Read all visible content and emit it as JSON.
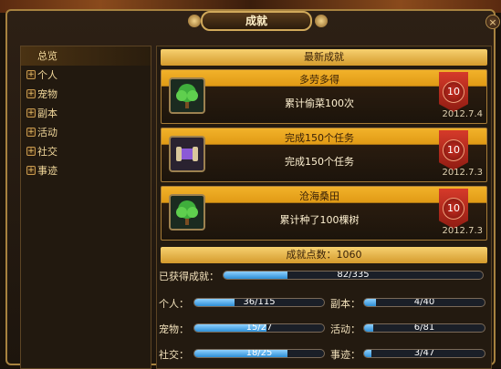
{
  "window": {
    "title": "成就",
    "close_label": "×"
  },
  "sidebar": {
    "items": [
      {
        "label": "总览",
        "expandable": false,
        "selected": true
      },
      {
        "label": "个人",
        "expandable": true
      },
      {
        "label": "宠物",
        "expandable": true
      },
      {
        "label": "副本",
        "expandable": true
      },
      {
        "label": "活动",
        "expandable": true
      },
      {
        "label": "社交",
        "expandable": true
      },
      {
        "label": "事迹",
        "expandable": true
      }
    ],
    "expand_glyph": "+"
  },
  "recent": {
    "header": "最新成就",
    "cards": [
      {
        "title": "多劳多得",
        "desc": "累计偷菜100次",
        "points": "10",
        "date": "2012.7.4",
        "icon": "tree-icon"
      },
      {
        "title": "完成150个任务",
        "desc": "完成150个任务",
        "points": "10",
        "date": "2012.7.3",
        "icon": "scroll-icon"
      },
      {
        "title": "沧海桑田",
        "desc": "累计种了100棵树",
        "points": "10",
        "date": "2012.7.3",
        "icon": "tree-icon"
      }
    ]
  },
  "points": {
    "label": "成就点数：1060"
  },
  "progress": {
    "total": {
      "label": "已获得成就：",
      "value": 82,
      "max": 335,
      "text": "82/335"
    },
    "stats": [
      {
        "label": "个人：",
        "value": 36,
        "max": 115,
        "text": "36/115"
      },
      {
        "label": "副本：",
        "value": 4,
        "max": 40,
        "text": "4/40"
      },
      {
        "label": "宠物：",
        "value": 15,
        "max": 27,
        "text": "15/27"
      },
      {
        "label": "活动：",
        "value": 6,
        "max": 81,
        "text": "6/81"
      },
      {
        "label": "社交：",
        "value": 18,
        "max": 25,
        "text": "18/25"
      },
      {
        "label": "事迹：",
        "value": 3,
        "max": 47,
        "text": "3/47"
      }
    ]
  },
  "colors": {
    "gold": "#f2b22a",
    "frame": "#a7823f",
    "bar_fill": "#2d8fd6",
    "badge": "#c82f23"
  }
}
